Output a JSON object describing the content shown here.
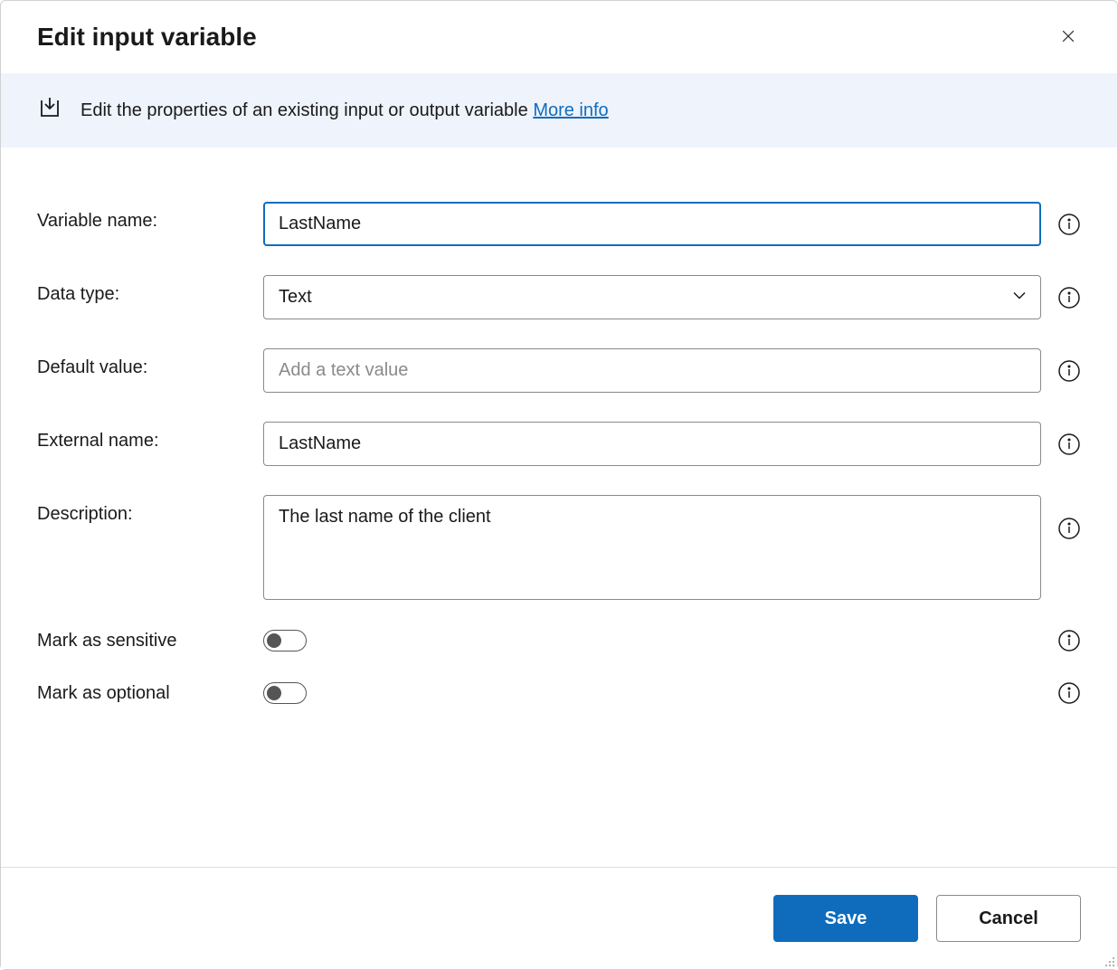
{
  "dialog": {
    "title": "Edit input variable"
  },
  "banner": {
    "text": "Edit the properties of an existing input or output variable ",
    "link": "More info"
  },
  "form": {
    "variableName": {
      "label": "Variable name:",
      "value": "LastName"
    },
    "dataType": {
      "label": "Data type:",
      "value": "Text"
    },
    "defaultValue": {
      "label": "Default value:",
      "placeholder": "Add a text value",
      "value": ""
    },
    "externalName": {
      "label": "External name:",
      "value": "LastName"
    },
    "description": {
      "label": "Description:",
      "value": "The last name of the client"
    },
    "sensitive": {
      "label": "Mark as sensitive",
      "value": false
    },
    "optional": {
      "label": "Mark as optional",
      "value": false
    }
  },
  "footer": {
    "save": "Save",
    "cancel": "Cancel"
  }
}
